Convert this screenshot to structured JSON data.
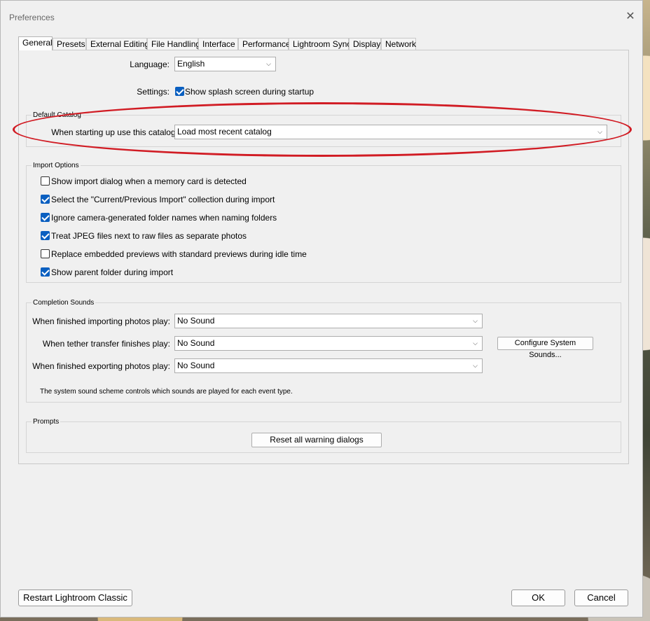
{
  "window": {
    "title": "Preferences"
  },
  "tabs": [
    "General",
    "Presets",
    "External Editing",
    "File Handling",
    "Interface",
    "Performance",
    "Lightroom Sync",
    "Display",
    "Network"
  ],
  "general": {
    "language_label": "Language:",
    "language_value": "English",
    "settings_label": "Settings:",
    "splash_label": "Show splash screen during startup",
    "splash_checked": true
  },
  "default_catalog": {
    "title": "Default Catalog",
    "label": "When starting up use this catalog:",
    "value": "Load most recent catalog"
  },
  "import_options": {
    "title": "Import Options",
    "items": [
      {
        "label": "Show import dialog when a memory card is detected",
        "checked": false
      },
      {
        "label": "Select the \"Current/Previous Import\" collection during import",
        "checked": true
      },
      {
        "label": "Ignore camera-generated folder names when naming folders",
        "checked": true
      },
      {
        "label": "Treat JPEG files next to raw files as separate photos",
        "checked": true
      },
      {
        "label": "Replace embedded previews with standard previews during idle time",
        "checked": false
      },
      {
        "label": "Show parent folder during import",
        "checked": true
      }
    ]
  },
  "completion_sounds": {
    "title": "Completion Sounds",
    "importing_label": "When finished importing photos play:",
    "importing_value": "No Sound",
    "tether_label": "When tether transfer finishes play:",
    "tether_value": "No Sound",
    "exporting_label": "When finished exporting photos play:",
    "exporting_value": "No Sound",
    "configure_button": "Configure System Sounds...",
    "note": "The system sound scheme controls which sounds are played for each event type."
  },
  "prompts": {
    "title": "Prompts",
    "reset_button": "Reset all warning dialogs"
  },
  "footer": {
    "restart_button": "Restart Lightroom Classic",
    "ok_button": "OK",
    "cancel_button": "Cancel"
  },
  "colors": {
    "accent": "#0a5fc0",
    "annotation": "#d11c24"
  }
}
